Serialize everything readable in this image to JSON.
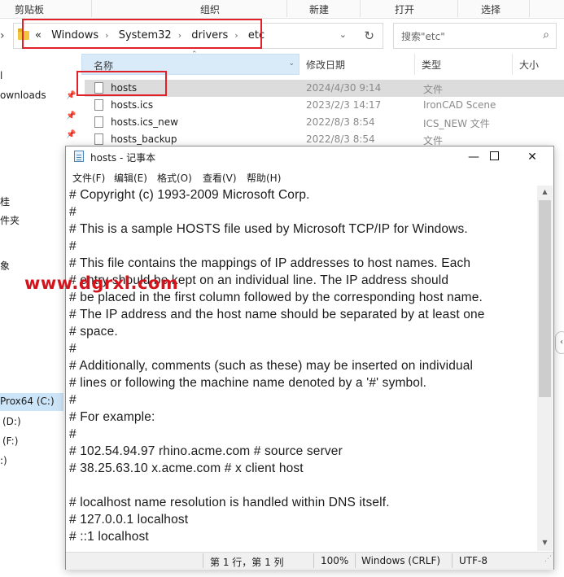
{
  "ribbon": {
    "groups": [
      "剪贴板",
      "组织",
      "新建",
      "打开",
      "选择"
    ]
  },
  "address": {
    "overflow": "«",
    "crumbs": [
      "Windows",
      "System32",
      "drivers",
      "etc"
    ]
  },
  "search": {
    "placeholder": "搜索\"etc\""
  },
  "columns": {
    "name": "名称",
    "modified": "修改日期",
    "type": "类型",
    "size": "大小"
  },
  "files": [
    {
      "name": "hosts",
      "date": "2024/4/30 9:14",
      "type": "文件"
    },
    {
      "name": "hosts.ics",
      "date": "2023/2/3 14:17",
      "type": "IronCAD Scene"
    },
    {
      "name": "hosts.ics_new",
      "date": "2022/8/3 8:54",
      "type": "ICS_NEW 文件"
    },
    {
      "name": "hosts_backup",
      "date": "2022/8/3 8:54",
      "type": "文件"
    }
  ],
  "sidebar": {
    "items": [
      "ownloads",
      "Prox64 (C:)",
      "(D:)",
      "(F:)"
    ],
    "partials": [
      "l",
      "桂",
      "件夹",
      "象",
      ":)"
    ]
  },
  "notepad": {
    "title": "hosts - 记事本",
    "menu": [
      "文件(F)",
      "编辑(E)",
      "格式(O)",
      "查看(V)",
      "帮助(H)"
    ],
    "lines": [
      "# Copyright (c) 1993-2009 Microsoft Corp.",
      "#",
      "# This is a sample HOSTS file used by Microsoft TCP/IP for Windows.",
      "#",
      "# This file contains the mappings of IP addresses to host names. Each",
      "# entry should be kept on an individual line. The IP address should",
      "# be placed in the first column followed by the corresponding host name.",
      "# The IP address and the host name should be separated by at least one",
      "# space.",
      "#",
      "# Additionally, comments (such as these) may be inserted on individual",
      "# lines or following the machine name denoted by a '#' symbol.",
      "#",
      "# For example:",
      "#",
      "# 102.54.94.97 rhino.acme.com # source server",
      "# 38.25.63.10 x.acme.com # x client host",
      "",
      "# localhost name resolution is handled within DNS itself.",
      "# 127.0.0.1 localhost",
      "# ::1 localhost"
    ],
    "status": {
      "position": "第 1 行，第 1 列",
      "zoom": "100%",
      "line_ending": "Windows (CRLF)",
      "encoding": "UTF-8"
    }
  },
  "watermark": "www.dgrxl.com",
  "accent_color": "#e0212a"
}
